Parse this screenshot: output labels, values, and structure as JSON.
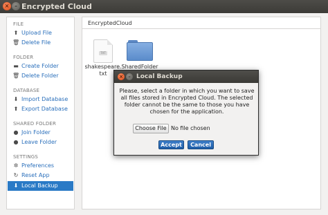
{
  "window": {
    "title": "Encrypted Cloud",
    "close_glyph": "×",
    "min_glyph": "–"
  },
  "sidebar": {
    "sections": [
      {
        "heading": "FILE",
        "items": [
          {
            "label": "Upload File",
            "icon": "upload-icon",
            "glyph": "⬆"
          },
          {
            "label": "Delete File",
            "icon": "trash-icon",
            "glyph": "🗑"
          }
        ]
      },
      {
        "heading": "FOLDER",
        "items": [
          {
            "label": "Create Folder",
            "icon": "folder-icon",
            "glyph": "▬"
          },
          {
            "label": "Delete Folder",
            "icon": "trash-icon",
            "glyph": "🗑"
          }
        ]
      },
      {
        "heading": "DATABASE",
        "items": [
          {
            "label": "Import Database",
            "icon": "download-icon",
            "glyph": "⬇"
          },
          {
            "label": "Export Database",
            "icon": "upload-icon",
            "glyph": "⬆"
          }
        ]
      },
      {
        "heading": "SHARED FOLDER",
        "items": [
          {
            "label": "Join Folder",
            "icon": "circle-plus-icon",
            "glyph": "●"
          },
          {
            "label": "Leave Folder",
            "icon": "circle-minus-icon",
            "glyph": "●"
          }
        ]
      },
      {
        "heading": "SETTINGS",
        "items": [
          {
            "label": "Preferences",
            "icon": "gear-icon",
            "glyph": "✲"
          },
          {
            "label": "Reset App",
            "icon": "refresh-icon",
            "glyph": "↻"
          },
          {
            "label": "Local Backup",
            "icon": "download-icon",
            "glyph": "⬇",
            "active": true
          }
        ]
      }
    ]
  },
  "main": {
    "path": "EncryptedCloud",
    "files": [
      {
        "name": "shakespeare.txt",
        "line1": "shakespeare.",
        "line2": "txt",
        "type": "text-file"
      },
      {
        "name": "SharedFolder",
        "line1": "SharedFolder",
        "line2": "",
        "type": "folder"
      }
    ]
  },
  "dialog": {
    "title": "Local Backup",
    "message": "Please, select a folder in which you want to save all files stored in Encrypted Cloud. The selected folder cannot be the same to those you have chosen for the application.",
    "choose_label": "Choose File",
    "no_file": "No file chosen",
    "accept_label": "Accept",
    "cancel_label": "Cancel",
    "close_glyph": "×",
    "min_glyph": "–"
  },
  "colors": {
    "accent": "#2a7ac6",
    "link": "#2a6fbb",
    "titlebar": "#3c3b37",
    "close": "#df4a16"
  }
}
